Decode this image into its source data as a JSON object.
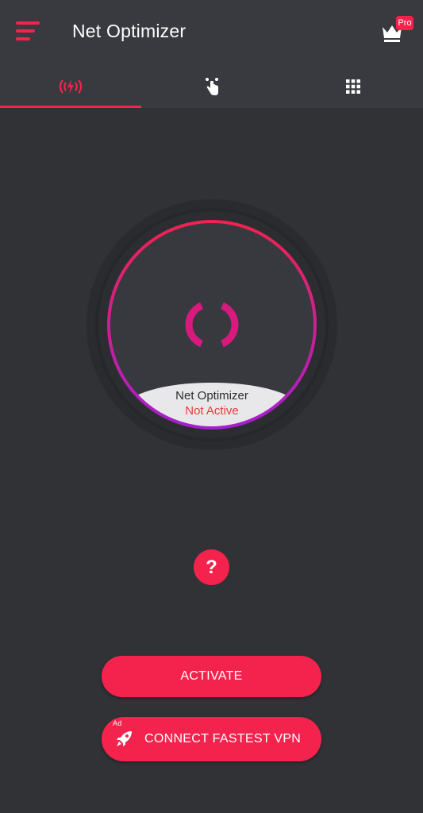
{
  "header": {
    "title": "Net Optimizer",
    "pro_badge": "Pro",
    "menu_icon": "hamburger-menu-icon",
    "crown_icon": "crown-icon"
  },
  "tabs": [
    {
      "icon": "signal-bolt-icon",
      "active": true
    },
    {
      "icon": "touch-hand-icon",
      "active": false
    },
    {
      "icon": "grid-icon",
      "active": false
    }
  ],
  "gauge": {
    "caption_title": "Net Optimizer",
    "caption_status": "Not Active"
  },
  "help": {
    "label": "?"
  },
  "buttons": {
    "activate_label": "ACTIVATE",
    "vpn_label": "CONNECT FASTEST VPN",
    "vpn_ad_tag": "Ad",
    "vpn_icon": "rocket-icon"
  },
  "colors": {
    "accent": "#f4234d",
    "background": "#313236",
    "header": "#393a3f",
    "status_inactive": "#e53d3d",
    "ring_gradient_start": "#f0234f",
    "ring_gradient_end": "#a51fd0",
    "spinner": "#d81a7e"
  }
}
